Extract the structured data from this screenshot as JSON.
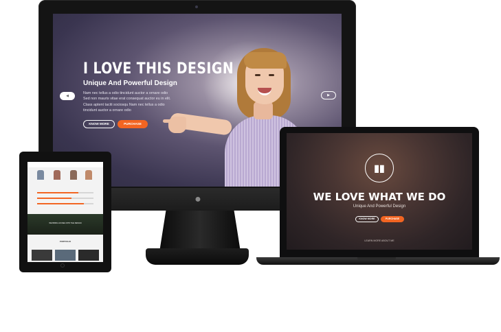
{
  "desktop": {
    "hero_title": "I LOVE THIS DESIGN",
    "hero_subtitle": "Unique And Powerful Design",
    "hero_body": [
      "Nam nec tellus a odio tincidunt auctor a ornare odio",
      "Sed non mauris vitae  erat consequat auctor eu in elit.",
      "Class aptent taciti sociosqu Nam nec tellus a odio",
      "tincidunt auctor a ornare odio"
    ],
    "know_more_label": "KNOW MORE",
    "purchase_label": "PURCHASE",
    "prev_label": "◀",
    "next_label": "▶"
  },
  "laptop": {
    "title": "WE LOVE WHAT WE DO",
    "subtitle": "Unique And Powerful Design",
    "know_more_label": "KNOW MORE",
    "purchase_label": "PURCHASE",
    "scroll_label": "LEARN MORE ABOUT ME"
  },
  "tablet": {
    "banner_text": "WE BRING AN IDEA INTO THE DESIGN",
    "section_title": "PORTFOLIO"
  },
  "colors": {
    "accent": "#f26522"
  },
  "icons": {
    "monitor_logo": "apple-logo-icon",
    "laptop_logo": "brand-logo-icon"
  }
}
